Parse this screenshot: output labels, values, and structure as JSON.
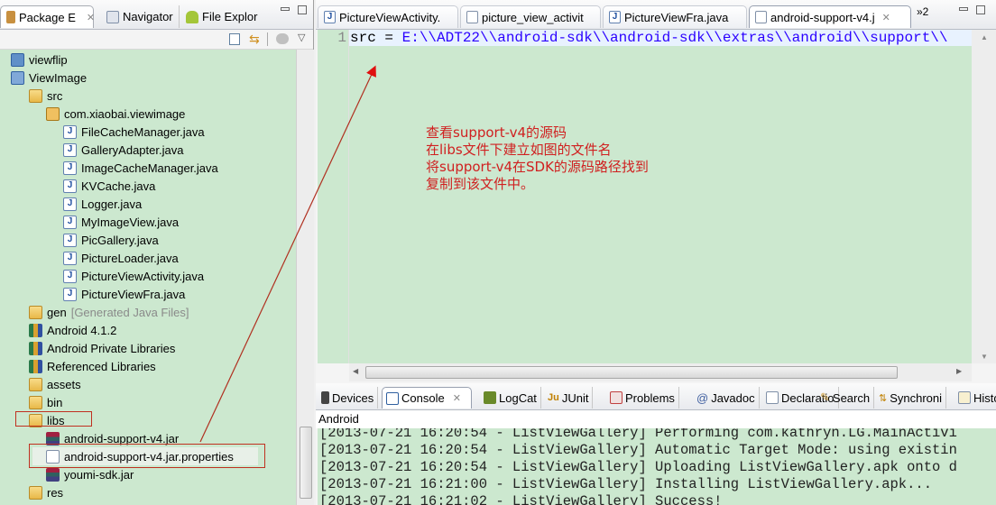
{
  "left_panel": {
    "tabs": [
      {
        "label": "Package E",
        "icon": "package-explorer-icon",
        "active": true
      },
      {
        "label": "Navigator",
        "icon": "navigator-icon",
        "active": false
      },
      {
        "label": "File Explor",
        "icon": "android-icon",
        "active": false
      }
    ],
    "tree": [
      {
        "label": "viewflip",
        "icon": "project-closed-icon",
        "depth": 0
      },
      {
        "label": "ViewImage",
        "icon": "android-project-icon",
        "depth": 0
      },
      {
        "label": "src",
        "icon": "source-folder-icon",
        "depth": 1
      },
      {
        "label": "com.xiaobai.viewimage",
        "icon": "package-icon",
        "depth": 2
      },
      {
        "label": "FileCacheManager.java",
        "icon": "java-file-icon",
        "depth": 3
      },
      {
        "label": "GalleryAdapter.java",
        "icon": "java-file-warning-icon",
        "depth": 3
      },
      {
        "label": "ImageCacheManager.java",
        "icon": "java-file-warning-icon",
        "depth": 3
      },
      {
        "label": "KVCache.java",
        "icon": "java-file-icon",
        "depth": 3
      },
      {
        "label": "Logger.java",
        "icon": "java-file-warning-icon",
        "depth": 3
      },
      {
        "label": "MyImageView.java",
        "icon": "java-file-icon",
        "depth": 3
      },
      {
        "label": "PicGallery.java",
        "icon": "java-file-warning-icon",
        "depth": 3
      },
      {
        "label": "PictureLoader.java",
        "icon": "java-file-icon",
        "depth": 3
      },
      {
        "label": "PictureViewActivity.java",
        "icon": "java-file-warning-icon",
        "depth": 3
      },
      {
        "label": "PictureViewFra.java",
        "icon": "java-file-warning-icon",
        "depth": 3
      },
      {
        "label": "gen",
        "suffix": "[Generated Java Files]",
        "icon": "source-folder-icon",
        "depth": 1
      },
      {
        "label": "Android 4.1.2",
        "icon": "library-icon",
        "depth": 1
      },
      {
        "label": "Android Private Libraries",
        "icon": "library-icon",
        "depth": 1
      },
      {
        "label": "Referenced Libraries",
        "icon": "library-icon",
        "depth": 1
      },
      {
        "label": "assets",
        "icon": "folder-icon",
        "depth": 1
      },
      {
        "label": "bin",
        "icon": "folder-icon",
        "depth": 1
      },
      {
        "label": "libs",
        "icon": "folder-icon",
        "depth": 1,
        "highlighted": true
      },
      {
        "label": "android-support-v4.jar",
        "icon": "jar-icon",
        "depth": 2
      },
      {
        "label": "android-support-v4.jar.properties",
        "icon": "text-file-icon",
        "depth": 2,
        "highlighted": true,
        "selected": true
      },
      {
        "label": "youmi-sdk.jar",
        "icon": "jar-icon",
        "depth": 2
      },
      {
        "label": "res",
        "icon": "folder-icon",
        "depth": 1
      }
    ]
  },
  "editor": {
    "tabs": [
      {
        "label": "PictureViewActivity.",
        "icon": "java-file-warning-icon",
        "active": false
      },
      {
        "label": "picture_view_activit",
        "icon": "xml-file-icon",
        "active": false
      },
      {
        "label": "PictureViewFra.java",
        "icon": "java-file-warning-icon",
        "active": false
      },
      {
        "label": "android-support-v4.j",
        "icon": "text-file-icon",
        "active": true
      }
    ],
    "overflow_label": "»2",
    "line_number": "1",
    "code_line": "src = E:\\\\ADT22\\\\android-sdk\\\\android-sdk\\\\extras\\\\android\\\\support\\\\",
    "annotation": [
      "查看support-v4的源码",
      "在libs文件下建立如图的文件名",
      "将support-v4在SDK的源码路径找到",
      "复制到该文件中。"
    ],
    "annotation_color": "#d02020"
  },
  "console": {
    "tabs": [
      {
        "label": "Devices",
        "icon": "device-icon"
      },
      {
        "label": "Console",
        "icon": "console-icon",
        "active": true
      },
      {
        "label": "LogCat",
        "icon": "logcat-icon"
      },
      {
        "label": "JUnit",
        "icon": "junit-icon"
      },
      {
        "label": "Problems",
        "icon": "problems-icon"
      },
      {
        "label": "Javadoc",
        "icon": "javadoc-icon"
      },
      {
        "label": "Declaratio",
        "icon": "declaration-icon"
      },
      {
        "label": "Search",
        "icon": "search-icon"
      },
      {
        "label": "Synchroni",
        "icon": "synchronize-icon"
      },
      {
        "label": "Histo",
        "icon": "history-icon"
      }
    ],
    "label": "Android",
    "lines": [
      "[2013-07-21 16:20:54 - ListViewGallery] Performing com.kathryn.LG.MainActivi",
      "[2013-07-21 16:20:54 - ListViewGallery] Automatic Target Mode: using existin",
      "[2013-07-21 16:20:54 - ListViewGallery] Uploading ListViewGallery.apk onto d",
      "[2013-07-21 16:21:00 - ListViewGallery] Installing ListViewGallery.apk...",
      "[2013-07-21 16:21:02 - ListViewGallery] Success!"
    ]
  }
}
